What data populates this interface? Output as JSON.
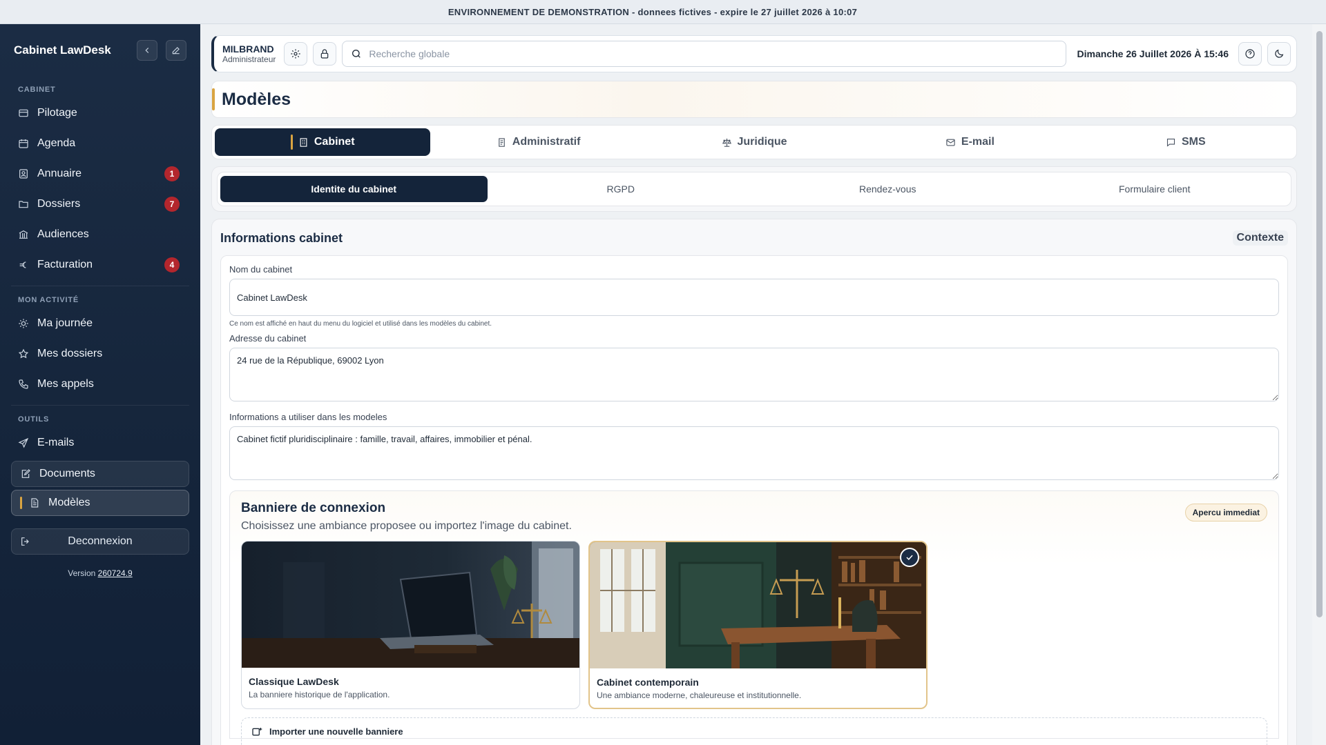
{
  "demo_banner": "ENVIRONNEMENT DE DEMONSTRATION - donnees fictives - expire le 27 juillet 2026 à 10:07",
  "sidebar": {
    "title": "Cabinet LawDesk",
    "sections": {
      "cabinet": "CABINET",
      "activite": "MON ACTIVITÉ",
      "outils": "OUTILS"
    },
    "cabinet_items": [
      {
        "label": "Pilotage",
        "icon": "dashboard-icon"
      },
      {
        "label": "Agenda",
        "icon": "calendar-icon"
      },
      {
        "label": "Annuaire",
        "icon": "contacts-icon",
        "badge": "1"
      },
      {
        "label": "Dossiers",
        "icon": "folder-icon",
        "badge": "7"
      },
      {
        "label": "Audiences",
        "icon": "courthouse-icon"
      },
      {
        "label": "Facturation",
        "icon": "euro-icon",
        "badge": "4"
      }
    ],
    "activite_items": [
      {
        "label": "Ma journée",
        "icon": "sun-icon"
      },
      {
        "label": "Mes dossiers",
        "icon": "star-icon"
      },
      {
        "label": "Mes appels",
        "icon": "phone-icon"
      }
    ],
    "outils_items": [
      {
        "label": "E-mails",
        "icon": "send-icon"
      },
      {
        "label": "Documents",
        "icon": "edit-document-icon"
      },
      {
        "label": "Modèles",
        "icon": "template-icon"
      }
    ],
    "logout": "Deconnexion",
    "version_label": "Version",
    "version_number": "260724.9"
  },
  "topbar": {
    "user_name": "MILBRAND",
    "user_role": "Administrateur",
    "search_placeholder": "Recherche globale",
    "datetime": "Dimanche 26 Juillet 2026 À 15:46"
  },
  "page": {
    "title": "Modèles",
    "tabs": [
      {
        "label": "Cabinet",
        "icon": "building-icon"
      },
      {
        "label": "Administratif",
        "icon": "document-icon"
      },
      {
        "label": "Juridique",
        "icon": "scale-icon"
      },
      {
        "label": "E-mail",
        "icon": "mail-icon"
      },
      {
        "label": "SMS",
        "icon": "chat-icon"
      }
    ],
    "subtabs": [
      "Identite du cabinet",
      "RGPD",
      "Rendez-vous",
      "Formulaire client"
    ]
  },
  "panel": {
    "title": "Informations cabinet",
    "context": "Contexte",
    "name_label": "Nom du cabinet",
    "name_value": "Cabinet LawDesk",
    "name_help": "Ce nom est affiché en haut du menu du logiciel et utilisé dans les modèles du cabinet.",
    "address_label": "Adresse du cabinet",
    "address_value": "24 rue de la République, 69002 Lyon",
    "info_label": "Informations a utiliser dans les modeles",
    "info_value": "Cabinet fictif pluridisciplinaire : famille, travail, affaires, immobilier et pénal."
  },
  "banner": {
    "title": "Banniere de connexion",
    "subtitle": "Choisissez une ambiance proposee ou importez l'image du cabinet.",
    "preview_badge": "Apercu immediat",
    "cards": [
      {
        "title": "Classique LawDesk",
        "desc": "La banniere historique de l'application."
      },
      {
        "title": "Cabinet contemporain",
        "desc": "Une ambiance moderne, chaleureuse et institutionnelle."
      }
    ],
    "import_label": "Importer une nouvelle banniere"
  }
}
